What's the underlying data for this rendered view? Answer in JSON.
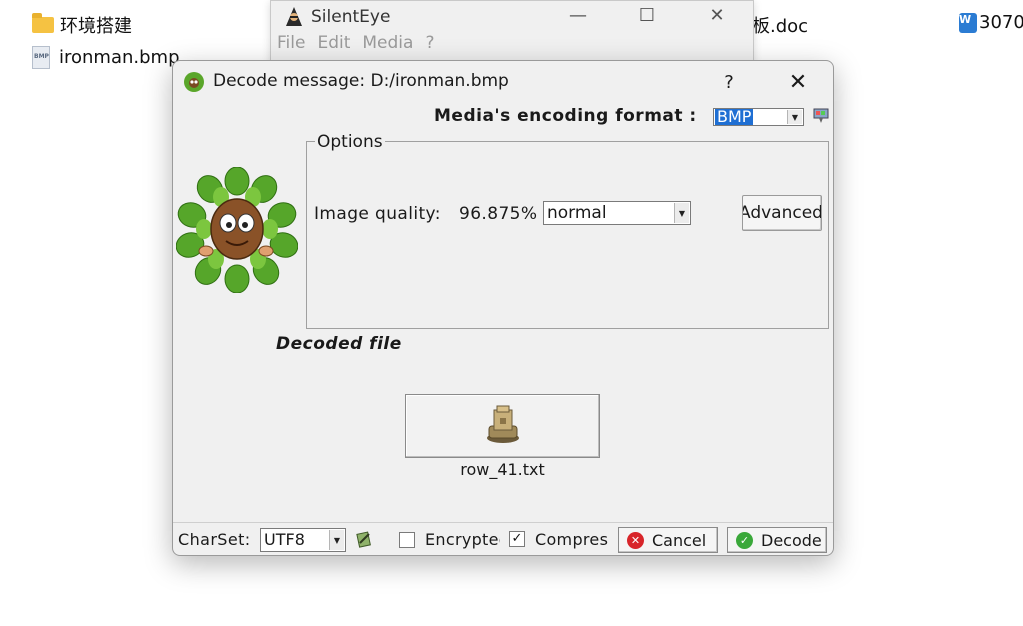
{
  "desktop": {
    "items": [
      {
        "label": "环境搭建"
      },
      {
        "label": "ironman.bmp"
      },
      {
        "label": "板.doc"
      },
      {
        "label": "3070"
      }
    ]
  },
  "bg_window": {
    "title": "SilentEye",
    "menu": [
      "File",
      "Edit",
      "Media",
      "?"
    ]
  },
  "dialog": {
    "title": "Decode message: D:/ironman.bmp",
    "help_label": "?",
    "close_label": "✕",
    "format_label": "Media's encoding format :",
    "format_value": "BMP",
    "options_legend": "Options",
    "image_quality_label": "Image quality:",
    "image_quality_value": "96.875%",
    "quality_mode": "normal",
    "advanced_label": "Advanced",
    "decoded_file_label": "Decoded file",
    "decoded_file_name": "row_41.txt",
    "charset_label": "CharSet:",
    "charset_value": "UTF8",
    "encrypted_label": "Encrypted",
    "encrypted_checked": false,
    "compress_label": "Compress",
    "compress_checked": true,
    "cancel_label": "Cancel",
    "decode_label": "Decode"
  }
}
